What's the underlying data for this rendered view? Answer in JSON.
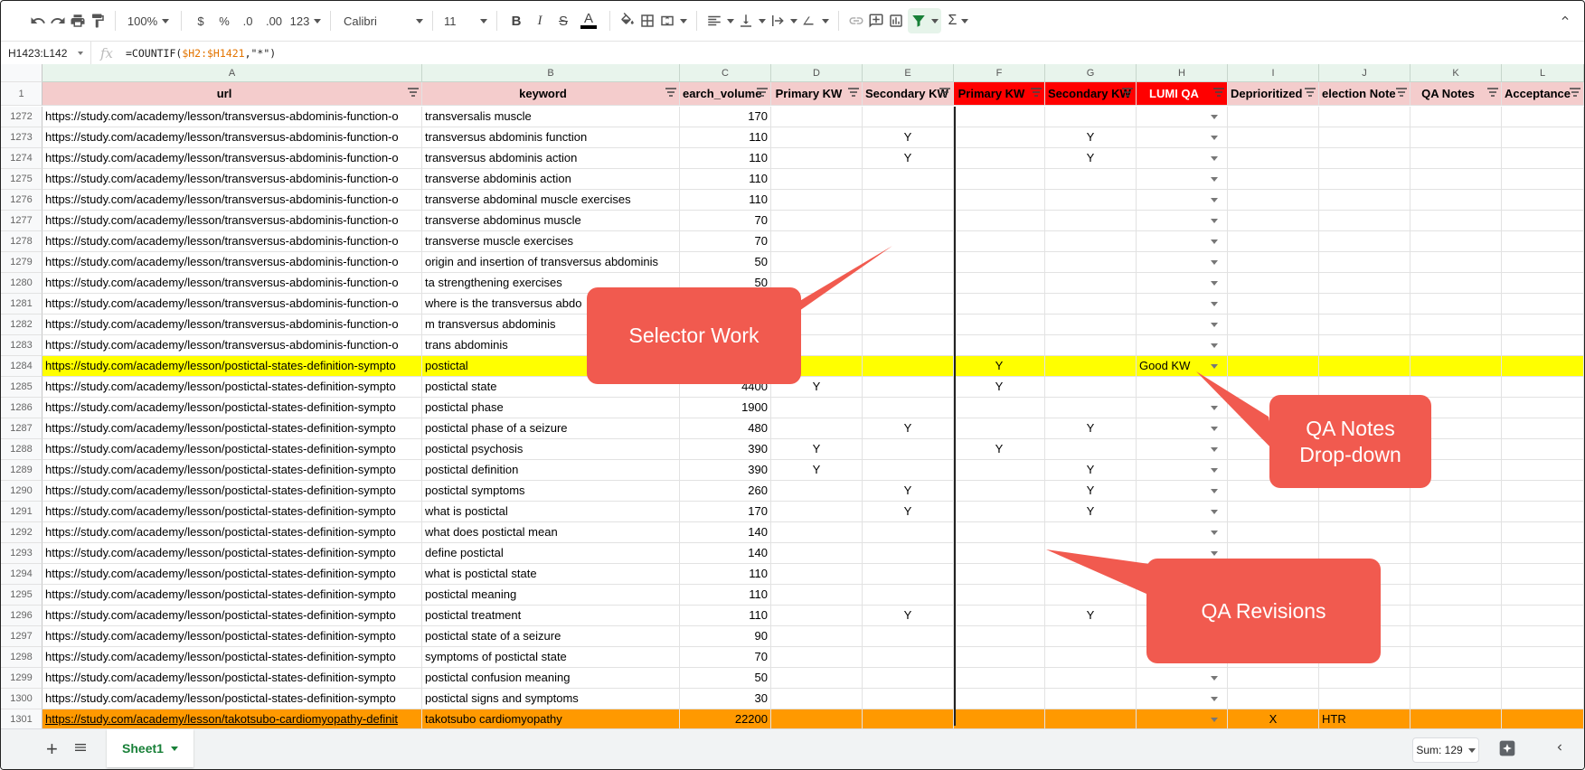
{
  "toolbar": {
    "zoom": "100%",
    "currency": "$",
    "percent": "%",
    "dec_decrease": ".0",
    "dec_increase": ".00",
    "more_formats": "123",
    "font": "Calibri",
    "font_size": "11",
    "sigma": "Σ"
  },
  "formula_bar": {
    "name_box": "H1423:L142",
    "fx": "fx",
    "formula_prefix": "=COUNTIF(",
    "formula_ref": "$H2:$H1421",
    "formula_suffix": ",\"*\")"
  },
  "columns": [
    "A",
    "B",
    "C",
    "D",
    "E",
    "F",
    "G",
    "H",
    "I",
    "J",
    "K",
    "L"
  ],
  "header_row": {
    "row_num": "1",
    "cells": [
      "url",
      "keyword",
      "earch_volume",
      "Primary KW",
      "Secondary KW",
      "Primary KW",
      "Secondary KW",
      "LUMI QA",
      "Deprioritized",
      "election Note",
      "QA Notes",
      "Acceptance"
    ]
  },
  "rows": [
    {
      "n": "1272",
      "url": "https://study.com/academy/lesson/transversus-abdominis-function-o",
      "kw": "transversalis muscle",
      "vol": "170",
      "d": "",
      "e": "",
      "f": "",
      "g": "",
      "h": "",
      "i": "",
      "j": ""
    },
    {
      "n": "1273",
      "url": "https://study.com/academy/lesson/transversus-abdominis-function-o",
      "kw": "transversus abdominis function",
      "vol": "110",
      "d": "",
      "e": "Y",
      "f": "",
      "g": "Y",
      "h": "",
      "i": "",
      "j": ""
    },
    {
      "n": "1274",
      "url": "https://study.com/academy/lesson/transversus-abdominis-function-o",
      "kw": "transversus abdominis action",
      "vol": "110",
      "d": "",
      "e": "Y",
      "f": "",
      "g": "Y",
      "h": "",
      "i": "",
      "j": ""
    },
    {
      "n": "1275",
      "url": "https://study.com/academy/lesson/transversus-abdominis-function-o",
      "kw": "transverse abdominis action",
      "vol": "110",
      "d": "",
      "e": "",
      "f": "",
      "g": "",
      "h": "",
      "i": "",
      "j": ""
    },
    {
      "n": "1276",
      "url": "https://study.com/academy/lesson/transversus-abdominis-function-o",
      "kw": "transverse abdominal muscle exercises",
      "vol": "110",
      "d": "",
      "e": "",
      "f": "",
      "g": "",
      "h": "",
      "i": "",
      "j": ""
    },
    {
      "n": "1277",
      "url": "https://study.com/academy/lesson/transversus-abdominis-function-o",
      "kw": "transverse abdominus muscle",
      "vol": "70",
      "d": "",
      "e": "",
      "f": "",
      "g": "",
      "h": "",
      "i": "",
      "j": ""
    },
    {
      "n": "1278",
      "url": "https://study.com/academy/lesson/transversus-abdominis-function-o",
      "kw": "transverse muscle exercises",
      "vol": "70",
      "d": "",
      "e": "",
      "f": "",
      "g": "",
      "h": "",
      "i": "",
      "j": ""
    },
    {
      "n": "1279",
      "url": "https://study.com/academy/lesson/transversus-abdominis-function-o",
      "kw": "origin and insertion of transversus abdominis",
      "vol": "50",
      "d": "",
      "e": "",
      "f": "",
      "g": "",
      "h": "",
      "i": "",
      "j": ""
    },
    {
      "n": "1280",
      "url": "https://study.com/academy/lesson/transversus-abdominis-function-o",
      "kw": "ta strengthening exercises",
      "vol": "50",
      "d": "",
      "e": "",
      "f": "",
      "g": "",
      "h": "",
      "i": "",
      "j": ""
    },
    {
      "n": "1281",
      "url": "https://study.com/academy/lesson/transversus-abdominis-function-o",
      "kw": "where is the transversus abdo",
      "vol": "",
      "d": "",
      "e": "",
      "f": "",
      "g": "",
      "h": "",
      "i": "",
      "j": ""
    },
    {
      "n": "1282",
      "url": "https://study.com/academy/lesson/transversus-abdominis-function-o",
      "kw": "m transversus abdominis",
      "vol": "",
      "d": "",
      "e": "",
      "f": "",
      "g": "",
      "h": "",
      "i": "",
      "j": ""
    },
    {
      "n": "1283",
      "url": "https://study.com/academy/lesson/transversus-abdominis-function-o",
      "kw": "trans abdominis",
      "vol": "",
      "d": "",
      "e": "",
      "f": "",
      "g": "",
      "h": "",
      "i": "",
      "j": ""
    },
    {
      "n": "1284",
      "url": "https://study.com/academy/lesson/postictal-states-definition-sympto",
      "kw": "postictal",
      "vol": "",
      "d": "",
      "e": "",
      "f": "Y",
      "g": "",
      "h": "Good KW",
      "i": "",
      "j": "",
      "hl": "#ffff00"
    },
    {
      "n": "1285",
      "url": "https://study.com/academy/lesson/postictal-states-definition-sympto",
      "kw": "postictal state",
      "vol": "4400",
      "d": "Y",
      "e": "",
      "f": "Y",
      "g": "",
      "h": "",
      "i": "",
      "j": ""
    },
    {
      "n": "1286",
      "url": "https://study.com/academy/lesson/postictal-states-definition-sympto",
      "kw": "postictal phase",
      "vol": "1900",
      "d": "",
      "e": "",
      "f": "",
      "g": "",
      "h": "",
      "i": "",
      "j": ""
    },
    {
      "n": "1287",
      "url": "https://study.com/academy/lesson/postictal-states-definition-sympto",
      "kw": "postictal phase of a seizure",
      "vol": "480",
      "d": "",
      "e": "Y",
      "f": "",
      "g": "Y",
      "h": "",
      "i": "",
      "j": ""
    },
    {
      "n": "1288",
      "url": "https://study.com/academy/lesson/postictal-states-definition-sympto",
      "kw": "postictal psychosis",
      "vol": "390",
      "d": "Y",
      "e": "",
      "f": "Y",
      "g": "",
      "h": "",
      "i": "",
      "j": ""
    },
    {
      "n": "1289",
      "url": "https://study.com/academy/lesson/postictal-states-definition-sympto",
      "kw": "postictal definition",
      "vol": "390",
      "d": "Y",
      "e": "",
      "f": "",
      "g": "Y",
      "h": "",
      "i": "",
      "j": ""
    },
    {
      "n": "1290",
      "url": "https://study.com/academy/lesson/postictal-states-definition-sympto",
      "kw": "postictal symptoms",
      "vol": "260",
      "d": "",
      "e": "Y",
      "f": "",
      "g": "Y",
      "h": "",
      "i": "",
      "j": ""
    },
    {
      "n": "1291",
      "url": "https://study.com/academy/lesson/postictal-states-definition-sympto",
      "kw": "what is postictal",
      "vol": "170",
      "d": "",
      "e": "Y",
      "f": "",
      "g": "Y",
      "h": "",
      "i": "",
      "j": ""
    },
    {
      "n": "1292",
      "url": "https://study.com/academy/lesson/postictal-states-definition-sympto",
      "kw": "what does postictal mean",
      "vol": "140",
      "d": "",
      "e": "",
      "f": "",
      "g": "",
      "h": "",
      "i": "",
      "j": ""
    },
    {
      "n": "1293",
      "url": "https://study.com/academy/lesson/postictal-states-definition-sympto",
      "kw": "define postictal",
      "vol": "140",
      "d": "",
      "e": "",
      "f": "",
      "g": "",
      "h": "",
      "i": "",
      "j": ""
    },
    {
      "n": "1294",
      "url": "https://study.com/academy/lesson/postictal-states-definition-sympto",
      "kw": "what is postictal state",
      "vol": "110",
      "d": "",
      "e": "",
      "f": "",
      "g": "",
      "h": "",
      "i": "",
      "j": ""
    },
    {
      "n": "1295",
      "url": "https://study.com/academy/lesson/postictal-states-definition-sympto",
      "kw": "postictal meaning",
      "vol": "110",
      "d": "",
      "e": "",
      "f": "",
      "g": "",
      "h": "",
      "i": "",
      "j": ""
    },
    {
      "n": "1296",
      "url": "https://study.com/academy/lesson/postictal-states-definition-sympto",
      "kw": "postictal treatment",
      "vol": "110",
      "d": "",
      "e": "Y",
      "f": "",
      "g": "Y",
      "h": "",
      "i": "",
      "j": ""
    },
    {
      "n": "1297",
      "url": "https://study.com/academy/lesson/postictal-states-definition-sympto",
      "kw": "postictal state of a seizure",
      "vol": "90",
      "d": "",
      "e": "",
      "f": "",
      "g": "",
      "h": "",
      "i": "",
      "j": ""
    },
    {
      "n": "1298",
      "url": "https://study.com/academy/lesson/postictal-states-definition-sympto",
      "kw": "symptoms of postictal state",
      "vol": "70",
      "d": "",
      "e": "",
      "f": "",
      "g": "",
      "h": "",
      "i": "",
      "j": ""
    },
    {
      "n": "1299",
      "url": "https://study.com/academy/lesson/postictal-states-definition-sympto",
      "kw": "postictal confusion meaning",
      "vol": "50",
      "d": "",
      "e": "",
      "f": "",
      "g": "",
      "h": "",
      "i": "",
      "j": ""
    },
    {
      "n": "1300",
      "url": "https://study.com/academy/lesson/postictal-states-definition-sympto",
      "kw": "postictal signs and symptoms",
      "vol": "30",
      "d": "",
      "e": "",
      "f": "",
      "g": "",
      "h": "",
      "i": "",
      "j": ""
    },
    {
      "n": "1301",
      "url": "https://study.com/academy/lesson/takotsubo-cardiomyopathy-definit",
      "kw": "takotsubo cardiomyopathy",
      "vol": "22200",
      "d": "",
      "e": "",
      "f": "",
      "g": "",
      "h": "",
      "i": "X",
      "j": "HTR",
      "hl": "#ff9900"
    }
  ],
  "callouts": {
    "selector": "Selector Work",
    "qa_notes_1": "QA Notes",
    "qa_notes_2": "Drop-down",
    "qa_revisions": "QA Revisions"
  },
  "bottom": {
    "sheet_name": "Sheet1",
    "sum": "Sum: 129"
  },
  "colors": {
    "header_pink": "#f4cccc",
    "header_red": "#ff0000",
    "row_yellow": "#ffff00",
    "row_orange": "#ff9900",
    "callout": "#f15a4f",
    "sheet_tab_green": "#188038"
  }
}
